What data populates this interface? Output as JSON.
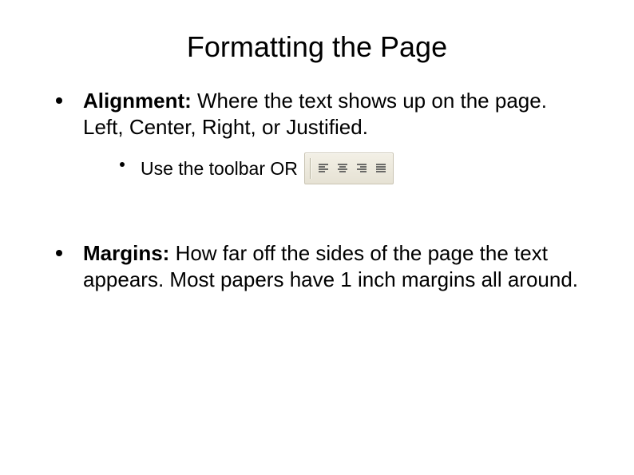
{
  "title": "Formatting the Page",
  "bullets": {
    "alignment": {
      "label": "Alignment:",
      "text": " Where the text shows up on the page. Left, Center, Right, or Justified.",
      "sub": {
        "text": "Use the toolbar OR"
      }
    },
    "margins": {
      "label": "Margins:",
      "text": " How far off the sides of the page the text appears. Most papers have 1 inch margins all around."
    }
  },
  "toolbar": {
    "buttons": [
      {
        "name": "align-left-button"
      },
      {
        "name": "align-center-button"
      },
      {
        "name": "align-right-button"
      },
      {
        "name": "align-justify-button"
      }
    ]
  }
}
